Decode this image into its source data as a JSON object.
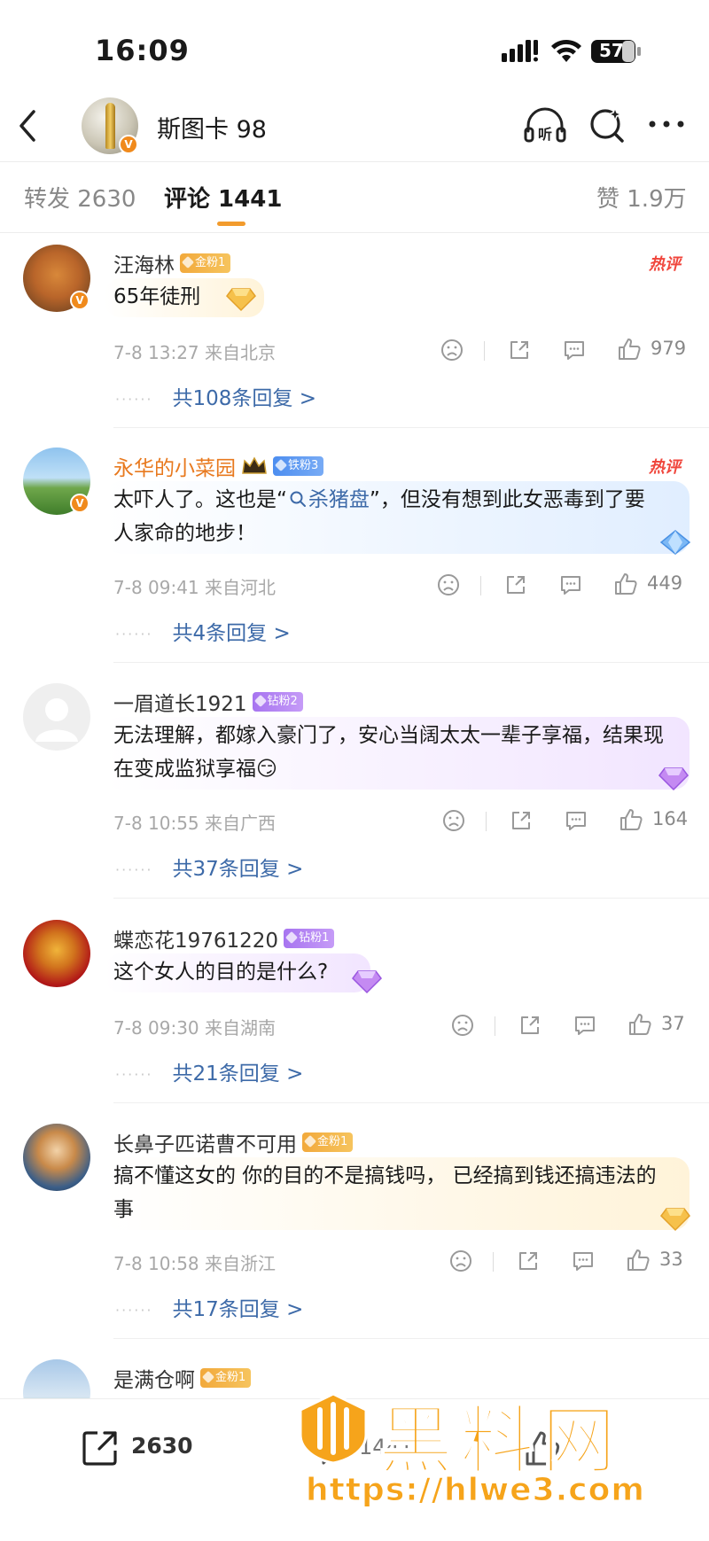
{
  "status_bar": {
    "time": "16:09",
    "battery": "57"
  },
  "header": {
    "title": "斯图卡 98",
    "listen_label": "听"
  },
  "tabs": [
    {
      "label": "转发 2630"
    },
    {
      "label": "评论 1441"
    },
    {
      "label": "赞 1.9万"
    }
  ],
  "comments": [
    {
      "name": "汪海林",
      "badge": "金粉1",
      "hot": "热评",
      "text_lines": [
        "65年徒刑"
      ],
      "time_location": "7-8 13:27  来自北京",
      "likes": "979",
      "replies": "共108条回复 >"
    },
    {
      "name": "永华的小菜园",
      "badge": "铁粉3",
      "hot": "热评",
      "text_lines": [
        "太吓人了。这也是“",
        "杀猪盘",
        "”，但没有想到此女恶毒到了要",
        "人家命的地步！"
      ],
      "time_location": "7-8 09:41  来自河北",
      "likes": "449",
      "replies": "共4条回复 >"
    },
    {
      "name": "一眉道长1921",
      "badge": "钻粉2",
      "text_lines": [
        "无法理解，都嫁入豪门了，安心当阔太太一辈子享福，结果现",
        "在变成监狱享福"
      ],
      "emoji": "😏",
      "time_location": "7-8 10:55  来自广西",
      "likes": "164",
      "replies": "共37条回复 >"
    },
    {
      "name": "蝶恋花19761220",
      "badge": "钻粉1",
      "text_lines": [
        "这个女人的目的是什么?"
      ],
      "time_location": "7-8 09:30  来自湖南",
      "likes": "37",
      "replies": "共21条回复 >"
    },
    {
      "name": "长鼻子匹诺曹不可用",
      "badge": "金粉1",
      "text_lines": [
        "搞不懂这女的 你的目的不是搞钱吗， 已经搞到钱还搞违法的",
        "事"
      ],
      "time_location": "7-8 10:58  来自浙江",
      "likes": "33",
      "replies": "共17条回复 >"
    },
    {
      "name": "是满仓啊",
      "badge": "金粉1"
    }
  ],
  "bottom_bar": {
    "share_count": "2630",
    "comment_count": "1441"
  },
  "watermark": {
    "title": "黑料网",
    "url": "https://hlwe3.com"
  },
  "colors": {
    "accent": "#f29b2d",
    "link": "#3d6aa8",
    "hot": "#f0463c",
    "watermark": "#f6a41b"
  }
}
